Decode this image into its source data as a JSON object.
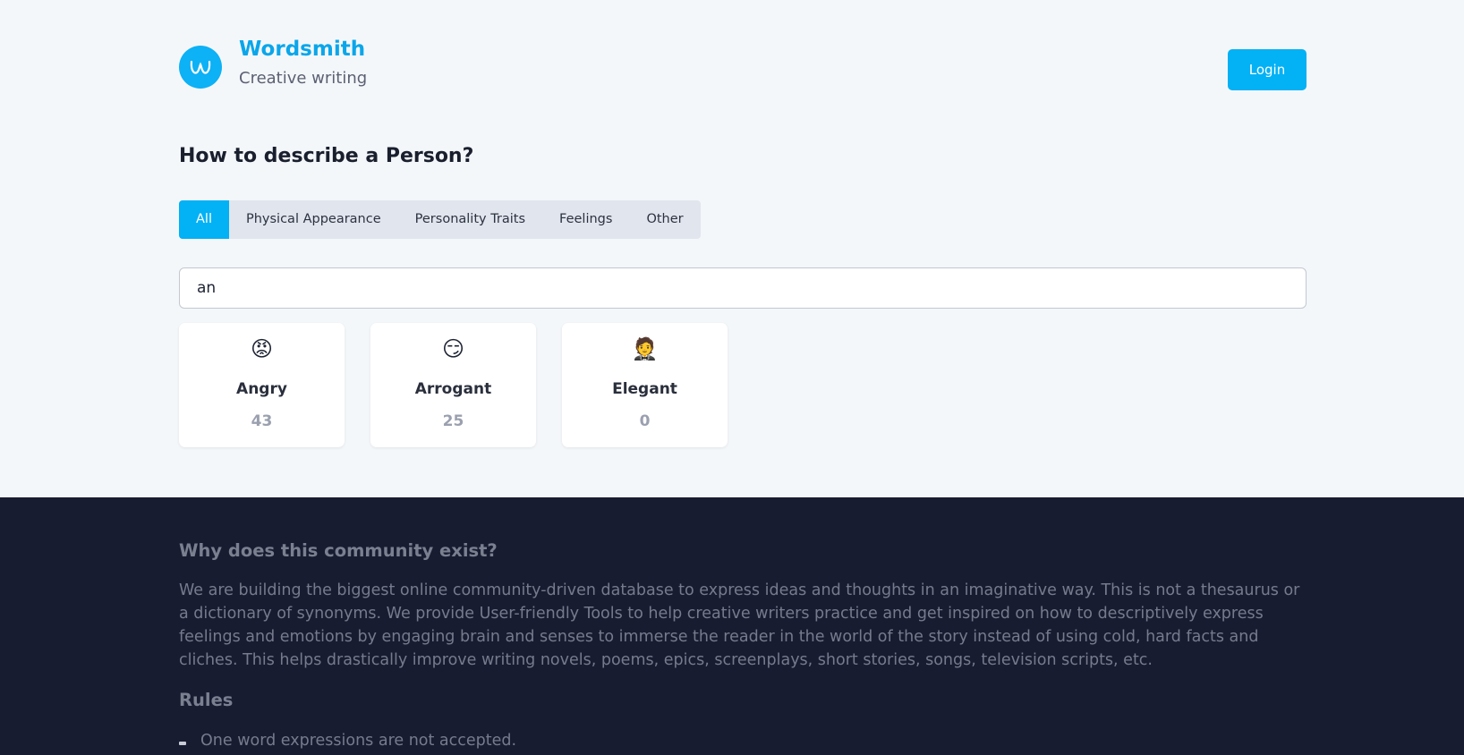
{
  "brand": {
    "name": "Wordsmith",
    "subtitle": "Creative writing",
    "logo_letter": "w",
    "accent": "#03b1f5"
  },
  "header": {
    "login_label": "Login"
  },
  "main": {
    "title": "How to describe a Person?",
    "tabs": [
      {
        "label": "All",
        "active": true
      },
      {
        "label": "Physical Appearance",
        "active": false
      },
      {
        "label": "Personality Traits",
        "active": false
      },
      {
        "label": "Feelings",
        "active": false
      },
      {
        "label": "Other",
        "active": false
      }
    ],
    "search": {
      "value": "an",
      "placeholder": ""
    },
    "cards": [
      {
        "emoji": "😡",
        "word": "Angry",
        "count": "43"
      },
      {
        "emoji": "😏",
        "word": "Arrogant",
        "count": "25"
      },
      {
        "emoji": "🤵",
        "word": "Elegant",
        "count": "0"
      }
    ]
  },
  "footer": {
    "why_title": "Why does this community exist?",
    "why_text": "We are building the biggest online community-driven database to express ideas and thoughts in an imaginative way. This is not a thesaurus or a dictionary of synonyms. We provide User-friendly Tools to help creative writers practice and get inspired on how to descriptively express feelings and emotions by engaging brain and senses to immerse the reader in the world of the story instead of using cold, hard facts and cliches. This helps drastically improve writing novels, poems, epics, screenplays, short stories, songs, television scripts, etc.",
    "rules_title": "Rules",
    "rules": [
      "One word expressions are not accepted."
    ]
  }
}
